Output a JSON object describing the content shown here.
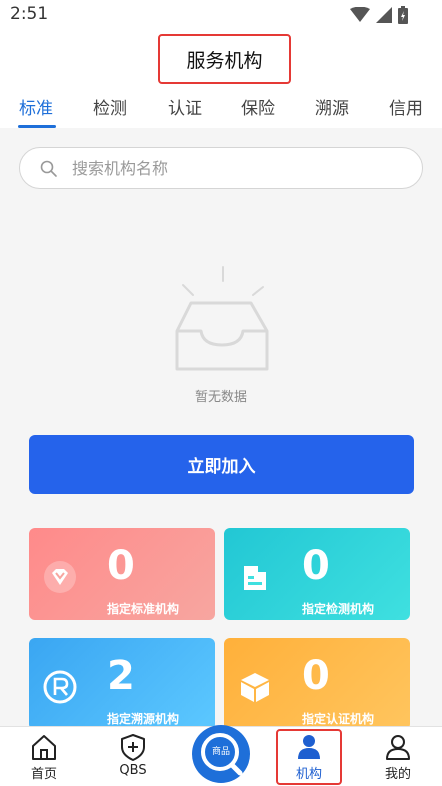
{
  "status": {
    "time": "2:51"
  },
  "header": {
    "title": "服务机构"
  },
  "tabs": [
    {
      "label": "标准",
      "active": true
    },
    {
      "label": "检测",
      "active": false
    },
    {
      "label": "认证",
      "active": false
    },
    {
      "label": "保险",
      "active": false
    },
    {
      "label": "溯源",
      "active": false
    },
    {
      "label": "信用",
      "active": false
    }
  ],
  "search": {
    "placeholder": "搜索机构名称",
    "value": ""
  },
  "empty": {
    "text": "暂无数据"
  },
  "join_button": {
    "label": "立即加入"
  },
  "stats": [
    {
      "count": "0",
      "label": "指定标准机构",
      "icon": "diamond-icon",
      "color": "#ff8a8a"
    },
    {
      "count": "0",
      "label": "指定检测机构",
      "icon": "document-icon",
      "color": "#22c7d4"
    },
    {
      "count": "2",
      "label": "指定溯源机构",
      "icon": "registered-icon",
      "color": "#3aa6f2"
    },
    {
      "count": "0",
      "label": "指定认证机构",
      "icon": "box-icon",
      "color": "#ffb03a"
    }
  ],
  "bottom_nav": {
    "items": [
      {
        "label": "首页",
        "icon": "home-icon"
      },
      {
        "label": "QBS",
        "icon": "shield-plus-icon"
      },
      {
        "label": "商品",
        "icon": "search-circle-icon"
      },
      {
        "label": "机构",
        "icon": "org-person-icon",
        "active": true
      },
      {
        "label": "我的",
        "icon": "user-icon"
      }
    ]
  },
  "colors": {
    "accent": "#1e6fd9",
    "button": "#2563eb",
    "highlight": "#e53935"
  }
}
